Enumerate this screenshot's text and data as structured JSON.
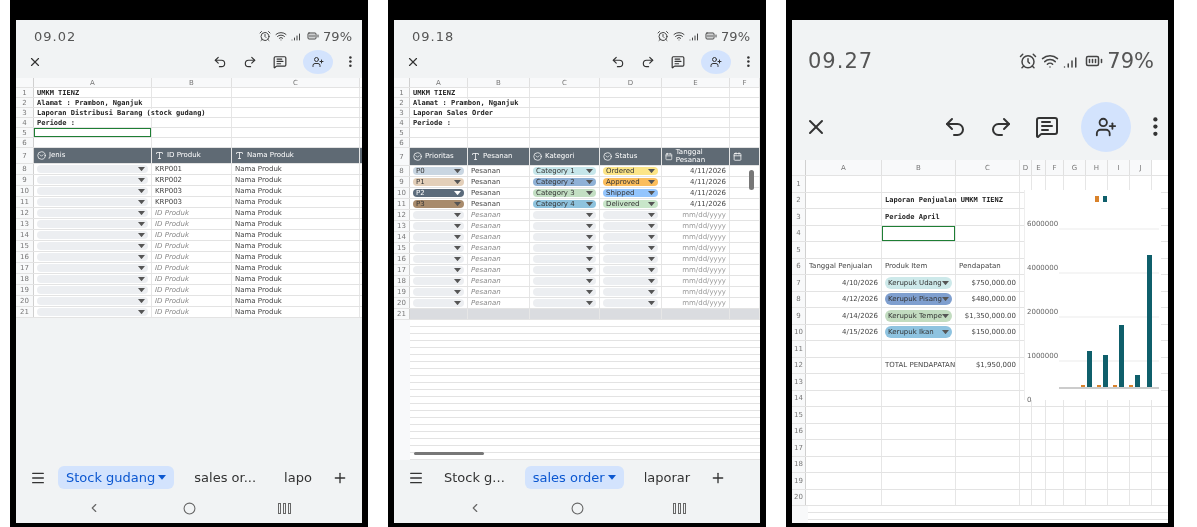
{
  "screens": [
    {
      "kind": "stock",
      "status": {
        "time": "09.02",
        "battery": "79%"
      },
      "sheet": {
        "columns": [
          "A",
          "B",
          "C"
        ],
        "rows": [
          {
            "number": "1",
            "cells": [
              {
                "kind": "title",
                "text": "UMKM TIENZ"
              }
            ]
          },
          {
            "number": "2",
            "cells": [
              {
                "kind": "title",
                "text": "Alamat : Prambon, Nganjuk"
              }
            ]
          },
          {
            "number": "3",
            "cells": [
              {
                "kind": "title",
                "text": "Laporan Distribusi Barang (stock gudang)"
              }
            ]
          },
          {
            "number": "4",
            "cells": [
              {
                "kind": "title",
                "text": "Periode :"
              }
            ]
          },
          {
            "number": "5",
            "cells": [
              {
                "kind": "selected"
              }
            ]
          },
          {
            "number": "6"
          },
          {
            "number": "7",
            "cells": [
              {
                "kind": "dropdown_header",
                "text": "Jenis"
              },
              {
                "kind": "text_header",
                "text": "ID Produk"
              },
              {
                "kind": "text_header",
                "text": "Nama Produk"
              }
            ]
          },
          {
            "number": "8",
            "cells": [
              {
                "kind": "chip"
              },
              {
                "kind": "text",
                "text": "KRP001"
              },
              {
                "kind": "text",
                "text": "Nama Produk"
              }
            ]
          },
          {
            "number": "9",
            "cells": [
              {
                "kind": "chip"
              },
              {
                "kind": "text",
                "text": "KRP002"
              },
              {
                "kind": "text",
                "text": "Nama Produk"
              }
            ]
          },
          {
            "number": "10",
            "cells": [
              {
                "kind": "chip"
              },
              {
                "kind": "text",
                "text": "KRP003"
              },
              {
                "kind": "text",
                "text": "Nama Produk"
              }
            ]
          },
          {
            "number": "11",
            "cells": [
              {
                "kind": "chip"
              },
              {
                "kind": "text",
                "text": "KRP003"
              },
              {
                "kind": "text",
                "text": "Nama Produk"
              }
            ]
          },
          {
            "number": "12",
            "cells": [
              {
                "kind": "chip"
              },
              {
                "kind": "hint",
                "text": "ID Produk"
              },
              {
                "kind": "text",
                "text": "Nama Produk"
              }
            ]
          },
          {
            "number": "13",
            "cells": [
              {
                "kind": "chip"
              },
              {
                "kind": "hint",
                "text": "ID Produk"
              },
              {
                "kind": "text",
                "text": "Nama Produk"
              }
            ]
          },
          {
            "number": "14",
            "cells": [
              {
                "kind": "chip"
              },
              {
                "kind": "hint",
                "text": "ID Produk"
              },
              {
                "kind": "text",
                "text": "Nama Produk"
              }
            ]
          },
          {
            "number": "15",
            "cells": [
              {
                "kind": "chip"
              },
              {
                "kind": "hint",
                "text": "ID Produk"
              },
              {
                "kind": "text",
                "text": "Nama Produk"
              }
            ]
          },
          {
            "number": "16",
            "cells": [
              {
                "kind": "chip"
              },
              {
                "kind": "hint",
                "text": "ID Produk"
              },
              {
                "kind": "text",
                "text": "Nama Produk"
              }
            ]
          },
          {
            "number": "17",
            "cells": [
              {
                "kind": "chip"
              },
              {
                "kind": "hint",
                "text": "ID Produk"
              },
              {
                "kind": "text",
                "text": "Nama Produk"
              }
            ]
          },
          {
            "number": "18",
            "cells": [
              {
                "kind": "chip"
              },
              {
                "kind": "hint",
                "text": "ID Produk"
              },
              {
                "kind": "text",
                "text": "Nama Produk"
              }
            ]
          },
          {
            "number": "19",
            "cells": [
              {
                "kind": "chip"
              },
              {
                "kind": "hint",
                "text": "ID Produk"
              },
              {
                "kind": "text",
                "text": "Nama Produk"
              }
            ]
          },
          {
            "number": "20",
            "cells": [
              {
                "kind": "chip"
              },
              {
                "kind": "hint",
                "text": "ID Produk"
              },
              {
                "kind": "text",
                "text": "Nama Produk"
              }
            ]
          },
          {
            "number": "21",
            "cells": [
              {
                "kind": "chip"
              },
              {
                "kind": "hint",
                "text": "ID Produk"
              },
              {
                "kind": "text",
                "text": "Nama Produk"
              }
            ]
          }
        ]
      },
      "tabs": [
        {
          "label": "Stock gudang",
          "selected": true
        },
        {
          "label": "sales or...",
          "selected": false
        },
        {
          "label": "lapo",
          "selected": false
        }
      ]
    },
    {
      "kind": "sales",
      "status": {
        "time": "09.18",
        "battery": "79%"
      },
      "sheet": {
        "columns": [
          "A",
          "B",
          "C",
          "D",
          "E",
          "F"
        ],
        "rows": [
          {
            "number": "1",
            "kind": "plain",
            "cells": [
              {
                "kind": "title",
                "text": "UMKM TIENZ"
              }
            ]
          },
          {
            "number": "2",
            "kind": "plain",
            "cells": [
              {
                "kind": "title",
                "text": "Alamat : Prambon, Nganjuk"
              }
            ]
          },
          {
            "number": "3",
            "kind": "plain",
            "cells": [
              {
                "kind": "title",
                "text": "Laporan Sales Order"
              }
            ]
          },
          {
            "number": "4",
            "kind": "plain",
            "cells": [
              {
                "kind": "title",
                "text": "Periode :"
              }
            ]
          },
          {
            "number": "5",
            "kind": "plain"
          },
          {
            "number": "6",
            "kind": "plain"
          },
          {
            "number": "7",
            "kind": "plain",
            "cells": [
              {
                "kind": "dropdown_header",
                "text": "Prioritas"
              },
              {
                "kind": "text_header",
                "text": "Pesanan"
              },
              {
                "kind": "dropdown_header",
                "text": "Kategori"
              },
              {
                "kind": "dropdown_header",
                "text": "Status"
              },
              {
                "kind": "date_header",
                "text": "Tanggal Pesanan"
              },
              {
                "kind": "date_header"
              }
            ]
          },
          {
            "number": "8",
            "kind": "plain",
            "cells": [
              {
                "kind": "chip",
                "text": "P0",
                "color": "#c9d6e2"
              },
              {
                "kind": "text",
                "text": "Pesanan"
              },
              {
                "kind": "chip",
                "text": "Category 1",
                "color": "#c6e6ea"
              },
              {
                "kind": "chip",
                "text": "Ordered",
                "color": "#fce588"
              },
              {
                "kind": "date",
                "text": "4/11/2026"
              }
            ]
          },
          {
            "number": "9",
            "kind": "plain",
            "cells": [
              {
                "kind": "chip",
                "text": "P1",
                "color": "#e3cfb9"
              },
              {
                "kind": "text",
                "text": "Pesanan"
              },
              {
                "kind": "chip",
                "text": "Category 2",
                "color": "#8fb1d6"
              },
              {
                "kind": "chip",
                "text": "Approved",
                "color": "#fbbd5c"
              },
              {
                "kind": "date",
                "text": "4/11/2026"
              }
            ]
          },
          {
            "number": "10",
            "kind": "plain",
            "cells": [
              {
                "kind": "chip",
                "text": "P2",
                "color": "#5b6b7b"
              },
              {
                "kind": "text",
                "text": "Pesanan"
              },
              {
                "kind": "chip",
                "text": "Category 3",
                "color": "#c3dfc3"
              },
              {
                "kind": "chip",
                "text": "Shipped",
                "color": "#93c5fd"
              },
              {
                "kind": "date",
                "text": "4/11/2026"
              }
            ]
          },
          {
            "number": "11",
            "kind": "plain",
            "cells": [
              {
                "kind": "chip",
                "text": "P3",
                "color": "#a88b6c"
              },
              {
                "kind": "text",
                "text": "Pesanan"
              },
              {
                "kind": "chip",
                "text": "Category 4",
                "color": "#8ec3de"
              },
              {
                "kind": "chip",
                "text": "Delivered",
                "color": "#c8e6c9"
              },
              {
                "kind": "date",
                "text": "4/11/2026"
              }
            ]
          },
          {
            "number": "12",
            "kind": "plain",
            "cells": [
              {
                "kind": "chip"
              },
              {
                "kind": "hint",
                "text": "Pesanan"
              },
              {
                "kind": "chip"
              },
              {
                "kind": "chip"
              },
              {
                "kind": "hint_date",
                "text": "mm/dd/yyyy"
              }
            ]
          },
          {
            "number": "13",
            "kind": "plain",
            "cells": [
              {
                "kind": "chip"
              },
              {
                "kind": "hint",
                "text": "Pesanan"
              },
              {
                "kind": "chip"
              },
              {
                "kind": "chip"
              },
              {
                "kind": "hint_date",
                "text": "mm/dd/yyyy"
              }
            ]
          },
          {
            "number": "14",
            "kind": "plain",
            "cells": [
              {
                "kind": "chip"
              },
              {
                "kind": "hint",
                "text": "Pesanan"
              },
              {
                "kind": "chip"
              },
              {
                "kind": "chip"
              },
              {
                "kind": "hint_date",
                "text": "mm/dd/yyyy"
              }
            ]
          },
          {
            "number": "15",
            "kind": "plain",
            "cells": [
              {
                "kind": "chip"
              },
              {
                "kind": "hint",
                "text": "Pesanan"
              },
              {
                "kind": "chip"
              },
              {
                "kind": "chip"
              },
              {
                "kind": "hint_date",
                "text": "mm/dd/yyyy"
              }
            ]
          },
          {
            "number": "16",
            "kind": "plain",
            "cells": [
              {
                "kind": "chip"
              },
              {
                "kind": "hint",
                "text": "Pesanan"
              },
              {
                "kind": "chip"
              },
              {
                "kind": "chip"
              },
              {
                "kind": "hint_date",
                "text": "mm/dd/yyyy"
              }
            ]
          },
          {
            "number": "17",
            "kind": "plain",
            "cells": [
              {
                "kind": "chip"
              },
              {
                "kind": "hint",
                "text": "Pesanan"
              },
              {
                "kind": "chip"
              },
              {
                "kind": "chip"
              },
              {
                "kind": "hint_date",
                "text": "mm/dd/yyyy"
              }
            ]
          },
          {
            "number": "18",
            "kind": "plain",
            "cells": [
              {
                "kind": "chip"
              },
              {
                "kind": "hint",
                "text": "Pesanan"
              },
              {
                "kind": "chip"
              },
              {
                "kind": "chip"
              },
              {
                "kind": "hint_date",
                "text": "mm/dd/yyyy"
              }
            ]
          },
          {
            "number": "19",
            "kind": "plain",
            "cells": [
              {
                "kind": "chip"
              },
              {
                "kind": "hint",
                "text": "Pesanan"
              },
              {
                "kind": "chip"
              },
              {
                "kind": "chip"
              },
              {
                "kind": "hint_date",
                "text": "mm/dd/yyyy"
              }
            ]
          },
          {
            "number": "20",
            "kind": "plain",
            "cells": [
              {
                "kind": "chip"
              },
              {
                "kind": "hint",
                "text": "Pesanan"
              },
              {
                "kind": "chip"
              },
              {
                "kind": "chip"
              },
              {
                "kind": "hint_date",
                "text": "mm/dd/yyyy"
              }
            ]
          },
          {
            "number": "21",
            "kind": "band"
          }
        ]
      },
      "tabs": [
        {
          "label": "Stock g...",
          "selected": false
        },
        {
          "label": "sales order",
          "selected": true
        },
        {
          "label": "laporar",
          "selected": false
        }
      ]
    },
    {
      "kind": "report",
      "status": {
        "time": "09.27",
        "battery": "79%"
      },
      "sheet": {
        "columns": [
          "A",
          "B",
          "C",
          "D",
          "E",
          "F",
          "G",
          "H",
          "I",
          "J"
        ],
        "rows": [
          {
            "number": "1"
          },
          {
            "number": "2",
            "cells": [
              {
                "kind": "empty"
              },
              {
                "kind": "title",
                "text": "Laporan Penjualan UMKM TIENZ"
              }
            ]
          },
          {
            "number": "3",
            "cells": [
              {
                "kind": "empty"
              },
              {
                "kind": "title",
                "text": "Periode April"
              }
            ]
          },
          {
            "number": "4",
            "cells": [
              {
                "kind": "empty"
              },
              {
                "kind": "selected"
              }
            ]
          },
          {
            "number": "5"
          },
          {
            "number": "6",
            "cells": [
              {
                "kind": "text",
                "text": "Tanggal Penjualan"
              },
              {
                "kind": "text",
                "text": "Produk Item"
              },
              {
                "kind": "text",
                "text": "Pendapatan"
              }
            ]
          },
          {
            "number": "7",
            "cells": [
              {
                "kind": "date",
                "text": "4/10/2026"
              },
              {
                "kind": "chip",
                "text": "Kerupuk Udang",
                "color": "#cde9ea"
              },
              {
                "kind": "date",
                "text": "$750,000.00"
              }
            ]
          },
          {
            "number": "8",
            "cells": [
              {
                "kind": "date",
                "text": "4/12/2026"
              },
              {
                "kind": "chip",
                "text": "Kerupuk Pisang",
                "color": "#7f9fcf"
              },
              {
                "kind": "date",
                "text": "$480,000.00"
              }
            ]
          },
          {
            "number": "9",
            "cells": [
              {
                "kind": "date",
                "text": "4/14/2026"
              },
              {
                "kind": "chip",
                "text": "Kerupuk Tempe",
                "color": "#c2dcc0"
              },
              {
                "kind": "date",
                "text": "$1,350,000.00"
              }
            ]
          },
          {
            "number": "10",
            "cells": [
              {
                "kind": "date",
                "text": "4/15/2026"
              },
              {
                "kind": "chip",
                "text": "Kerupuk Ikan",
                "color": "#8ec3e0"
              },
              {
                "kind": "date",
                "text": "$150,000.00"
              }
            ]
          },
          {
            "number": "11"
          },
          {
            "number": "12",
            "cells": [
              {
                "kind": "empty"
              },
              {
                "kind": "text",
                "text": "TOTAL PENDAPATAN"
              },
              {
                "kind": "date",
                "text": "$1,950,000"
              }
            ]
          },
          {
            "number": "13"
          },
          {
            "number": "14"
          },
          {
            "number": "15"
          },
          {
            "number": "16"
          },
          {
            "number": "17"
          },
          {
            "number": "18"
          },
          {
            "number": "19"
          },
          {
            "number": "20"
          }
        ]
      },
      "chart": {
        "y_labels": [
          "6000000",
          "4000000",
          "2000000",
          "1000000",
          "0"
        ]
      }
    }
  ]
}
